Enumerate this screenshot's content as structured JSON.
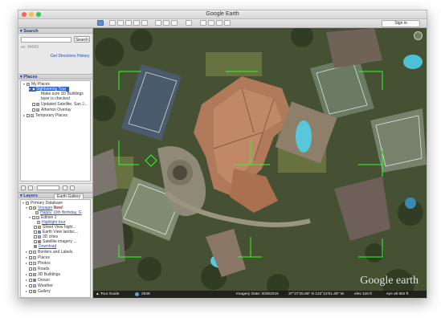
{
  "window": {
    "title": "Google Earth"
  },
  "toolbar": {
    "sign_in_label": "Sign in"
  },
  "search": {
    "header": "Search",
    "button_label": "Search",
    "hint": "ex: 94043",
    "get_directions": "Get Directions",
    "history": "History"
  },
  "places": {
    "header": "Places",
    "items": {
      "my_places": "My Places",
      "sightseeing_tour": "Sightseeing Tour",
      "tour_note_1": "Make sure 3D Buildings",
      "tour_note_2": "layer is checked",
      "updated_satellite": "Updated Satellite, San J...",
      "atherton_overlay": "Atherton Overlay",
      "temporary_places": "Temporary Places"
    }
  },
  "layers": {
    "header": "Layers",
    "tab_earth_gallery": "Earth Gallery",
    "items": {
      "primary_database": "Primary Database",
      "voyager": "Voyager",
      "voyager_badge": "New!",
      "happy_birthday": "Happy 10th Birthday, G",
      "edition": "Edition 1",
      "highlight_tour": "Highlight tour",
      "street_view": "Street View highl...",
      "earth_view": "Earth View landsc...",
      "cities_3d": "3D cities",
      "satellite_imagery": "Satellite imagery ...",
      "download": "Download",
      "borders": "Borders and Labels",
      "places": "Places",
      "photos": "Photos",
      "roads": "Roads",
      "buildings_3d": "3D Buildings",
      "ocean": "Ocean",
      "weather": "Weather",
      "gallery": "Gallery"
    }
  },
  "status": {
    "tour_guide": "Tour Guide",
    "year": "2948",
    "imagery_date": "Imagery Date: 3/28/2015",
    "coords": "37°27'25.85\" N  122°12'51.48\" W",
    "elev": "elev  115 ft",
    "eye_alt": "eye alt  562 ft"
  },
  "watermark": "Google earth",
  "colors": {
    "accent": "#1b4fb3",
    "new_badge": "#d21a1a",
    "overlay_lines": "#2aff2a"
  }
}
